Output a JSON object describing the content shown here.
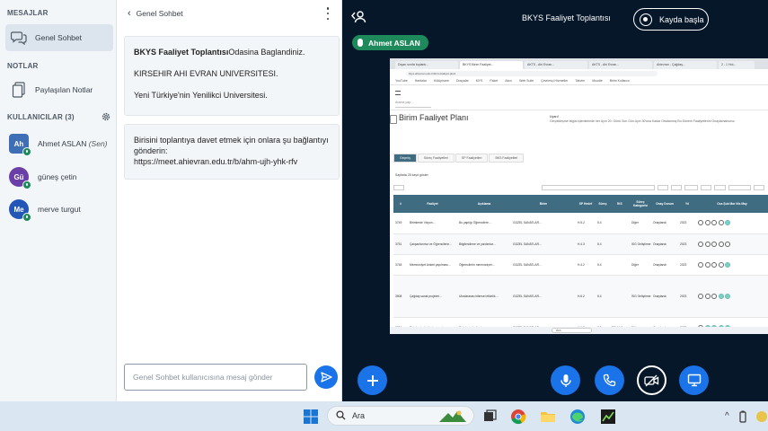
{
  "sidebar": {
    "messages_title": "MESAJLAR",
    "public_chat_label": "Genel Sohbet",
    "notes_title": "NOTLAR",
    "shared_notes_label": "Paylaşılan Notlar",
    "users_title": "KULLANICILAR (3)",
    "users": [
      {
        "initials": "Ah",
        "name": "Ahmet ASLAN",
        "suffix": "(Sen)",
        "color": "#3e6fb6"
      },
      {
        "initials": "Gü",
        "name": "güneş çetin",
        "color": "#6a3fa7"
      },
      {
        "initials": "Me",
        "name": "merve turgut",
        "color": "#2257b8"
      }
    ]
  },
  "chat": {
    "header_title": "Genel Sohbet",
    "welcome": {
      "bold": "BKYS Faaliyet Toplantısı",
      "rest": "Odasina Baglandiniz.",
      "line2": "KIRSEHIR AHI EVRAN UNIVERSITESI.",
      "line3": "Yeni Türkiye'nin Yenilikci Universitesi."
    },
    "invite": {
      "text": "Birisini toplantıya davet etmek için onlara şu bağlantıyı gönderin:",
      "link": "https://meet.ahievran.edu.tr/b/ahm-ujh-yhk-rfv"
    },
    "input_placeholder": "Genel Sohbet kullanıcısına mesaj gönder"
  },
  "main": {
    "meeting_title": "BKYS Faaliyet Toplantısı",
    "record_label": "Kayda başla",
    "presenter_name": "Ahmet ASLAN"
  },
  "shared_screen": {
    "tabs": [
      "Dışarı sınıfa toplantı...",
      "BKYS Birim Faaliyet...",
      "AKTS - Ahi Evran...",
      "AKTS - Ahi Evran...",
      "Ahievran - Çağdaş...",
      "2 - 1 Hot..."
    ],
    "address": "bkys.ahievran.edu.tr/birim-faaliyet-plani",
    "bookmarks": [
      "YouTube",
      "Haritalar",
      "Kütüphane",
      "Dosyalar",
      "MYS",
      "Paket",
      "Akıcı",
      "Web Suite",
      "Çevrimiçi Hizmetler",
      "Takvim",
      "Moodle",
      "Birim Kullanıcı"
    ],
    "search_placeholder": "Arama yap...",
    "page_title": "Birim Faaliyet Planı",
    "note_title": "Uyarı!",
    "note_text": "Gerçekleşme bilgisi işlemlerinde her Ayın 20. Günü Son Gün Ayın 30'una Kadar Ortalanmış Bu Dönem Faaliyetlerini Onaylamalısınız.",
    "page_tabs": [
      "Geçmiş",
      "Süreç Faaliyetleri",
      "SP Faaliyetleri",
      "BKS Faaliyetleri"
    ],
    "page_len": "Sayfada 25 kayıt göster",
    "columns": [
      "#",
      "Faaliyet",
      "Açıklama",
      "Birim",
      "SP Hedef",
      "Süreç",
      "İKS",
      "Süreç Kategorisi",
      "Onay Durum",
      "Yıl",
      "Oca Şub Mar Nis May"
    ],
    "rows": [
      {
        "id": "3749",
        "activity": "Birimlerde Vizyon…",
        "desc": "Bu yaptığı Öğrencilere…",
        "unit": "GÜZEL SANATLAR…",
        "sp": "H.5.2",
        "proc": "5.4",
        "iks": "",
        "cat": "Diğer",
        "status": "Onaylandı",
        "year": "2023",
        "filled": 1
      },
      {
        "id": "3751",
        "activity": "Çalışanlarımız ve Öğrencilerin…",
        "desc": "Bilgilendirme ve yardımlar…",
        "unit": "GÜZEL SANATLAR…",
        "sp": "H.4.3",
        "proc": "5.4",
        "iks": "",
        "cat": "İSG Geliştirme",
        "status": "Onaylandı",
        "year": "2023",
        "filled": 0
      },
      {
        "id": "3748",
        "activity": "Memnuniyet Anketi yapılması…",
        "desc": "Öğrencilerin memnuniyet…",
        "unit": "GÜZEL SANATLAR…",
        "sp": "H.4.2",
        "proc": "5.4",
        "iks": "",
        "cat": "Diğer",
        "status": "Onaylandı",
        "year": "2023",
        "filled": 1
      },
      {
        "id": "3508",
        "activity": "Çağdaş sanat projeleri…",
        "desc": "Uluslararası bilimsel etkinlik…",
        "unit": "GÜZEL SANATLAR…",
        "sp": "H.6.2",
        "proc": "5.4",
        "iks": "",
        "cat": "İSG Geliştirme",
        "status": "Onaylandı",
        "year": "2023",
        "filled": 2
      },
      {
        "id": "3226",
        "activity": "Birimlerde faaliyet sonuçları…",
        "desc": "Birimlerin faaliyet sonuç…",
        "unit": "GÜZEL SANATLAR…",
        "sp": "H.1.2",
        "proc": "2.3",
        "iks": "BS-14.2",
        "cat": "Diğer",
        "status": "Onaylandı",
        "year": "2023",
        "filled": 4
      },
      {
        "id": "3224",
        "activity": "İdari birimler süreçlerinin…",
        "desc": "Sağlık Bilgi Sistemleri…",
        "unit": "GÜZEL SANATLAR…",
        "sp": "H.1.2",
        "proc": "2.3",
        "iks": "",
        "cat": "Diğer",
        "status": "Onaylandı",
        "year": "2023",
        "filled": 3
      }
    ],
    "taskbar_search": "Ara"
  },
  "taskbar": {
    "search_label": "Ara"
  },
  "colors": {
    "accent": "#1a73e8",
    "presenter_green": "#1e8a5c",
    "presentation_bg": "#06172a",
    "table_header": "#3f6c80"
  }
}
